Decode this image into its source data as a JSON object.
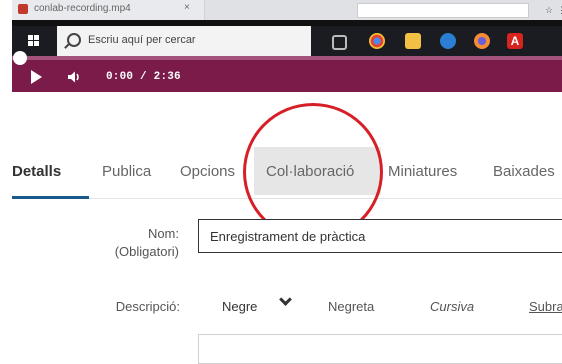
{
  "recording": {
    "tab_title": "conlab-recording.mp4",
    "close_glyph": "×"
  },
  "taskbar": {
    "search_placeholder": "Escriu aquí per cercar",
    "apps": [
      "task-view",
      "chrome",
      "files",
      "edge",
      "firefox",
      "acrobat"
    ]
  },
  "player": {
    "current_time": "0:00",
    "separator": "/",
    "duration": "2:36",
    "progress_percent": 0
  },
  "tabs": [
    {
      "label": "Detalls",
      "active": true
    },
    {
      "label": "Publica"
    },
    {
      "label": "Opcions"
    },
    {
      "label": "Col·laboració"
    },
    {
      "label": "Miniatures"
    },
    {
      "label": "Baixades"
    }
  ],
  "form": {
    "name_label": "Nom:",
    "name_required": "(Obligatori)",
    "name_value": "Enregistrament de pràctica",
    "description_label": "Descripció:",
    "toolbar": {
      "style_value": "Negre",
      "bold": "Negreta",
      "italic": "Cursiva",
      "underline": "Subra"
    }
  },
  "colors": {
    "player_bar": "#7a1b4a",
    "active_tab_underline": "#1a5a8a",
    "highlight_circle": "#d71f27"
  }
}
